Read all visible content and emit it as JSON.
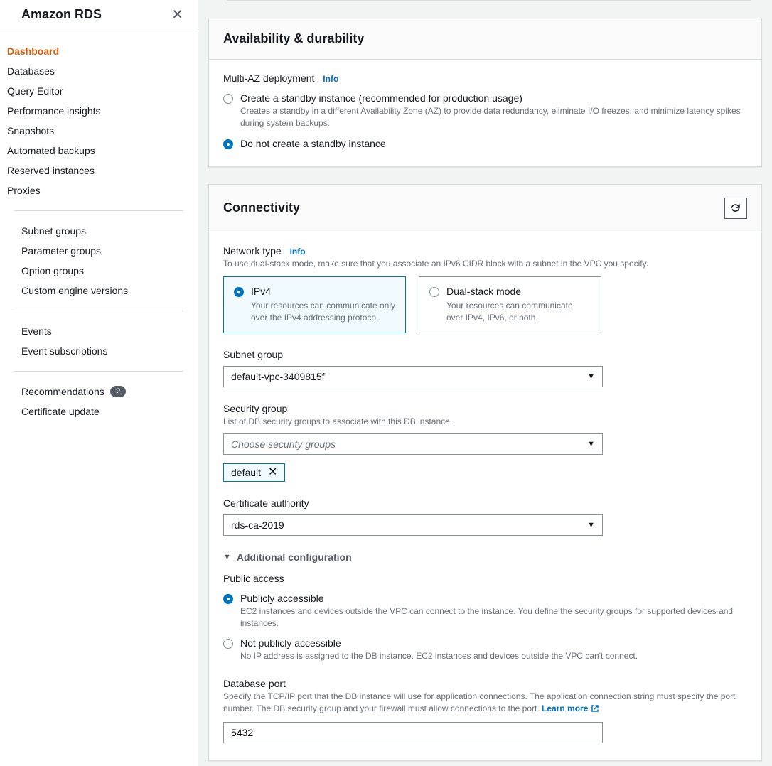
{
  "sidebar": {
    "title": "Amazon RDS",
    "sections": [
      [
        "Dashboard",
        "Databases",
        "Query Editor",
        "Performance insights",
        "Snapshots",
        "Automated backups",
        "Reserved instances",
        "Proxies"
      ],
      [
        "Subnet groups",
        "Parameter groups",
        "Option groups",
        "Custom engine versions"
      ],
      [
        "Events",
        "Event subscriptions"
      ],
      [
        "Recommendations",
        "Certificate update"
      ]
    ],
    "recommendations_badge": "2",
    "active": "Dashboard"
  },
  "availability": {
    "title": "Availability & durability",
    "multi_az_label": "Multi-AZ deployment",
    "info": "Info",
    "opt1_title": "Create a standby instance (recommended for production usage)",
    "opt1_desc": "Creates a standby in a different Availability Zone (AZ) to provide data redundancy, eliminate I/O freezes, and minimize latency spikes during system backups.",
    "opt2_title": "Do not create a standby instance"
  },
  "connectivity": {
    "title": "Connectivity",
    "network_type_label": "Network type",
    "info": "Info",
    "network_type_help": "To use dual-stack mode, make sure that you associate an IPv6 CIDR block with a subnet in the VPC you specify.",
    "ipv4_title": "IPv4",
    "ipv4_desc": "Your resources can communicate only over the IPv4 addressing protocol.",
    "dual_title": "Dual-stack mode",
    "dual_desc": "Your resources can communicate over IPv4, IPv6, or both.",
    "subnet_label": "Subnet group",
    "subnet_value": "default-vpc-3409815f",
    "sg_label": "Security group",
    "sg_help": "List of DB security groups to associate with this DB instance.",
    "sg_placeholder": "Choose security groups",
    "sg_chip": "default",
    "ca_label": "Certificate authority",
    "ca_value": "rds-ca-2019",
    "additional_label": "Additional configuration",
    "public_label": "Public access",
    "public_opt1_title": "Publicly accessible",
    "public_opt1_desc": "EC2 instances and devices outside the VPC can connect to the instance. You define the security groups for supported devices and instances.",
    "public_opt2_title": "Not publicly accessible",
    "public_opt2_desc": "No IP address is assigned to the DB instance. EC2 instances and devices outside the VPC can't connect.",
    "port_label": "Database port",
    "port_help": "Specify the TCP/IP port that the DB instance will use for application connections. The application connection string must specify the port number. The DB security group and your firewall must allow connections to the port. ",
    "learn_more": "Learn more",
    "port_value": "5432"
  }
}
